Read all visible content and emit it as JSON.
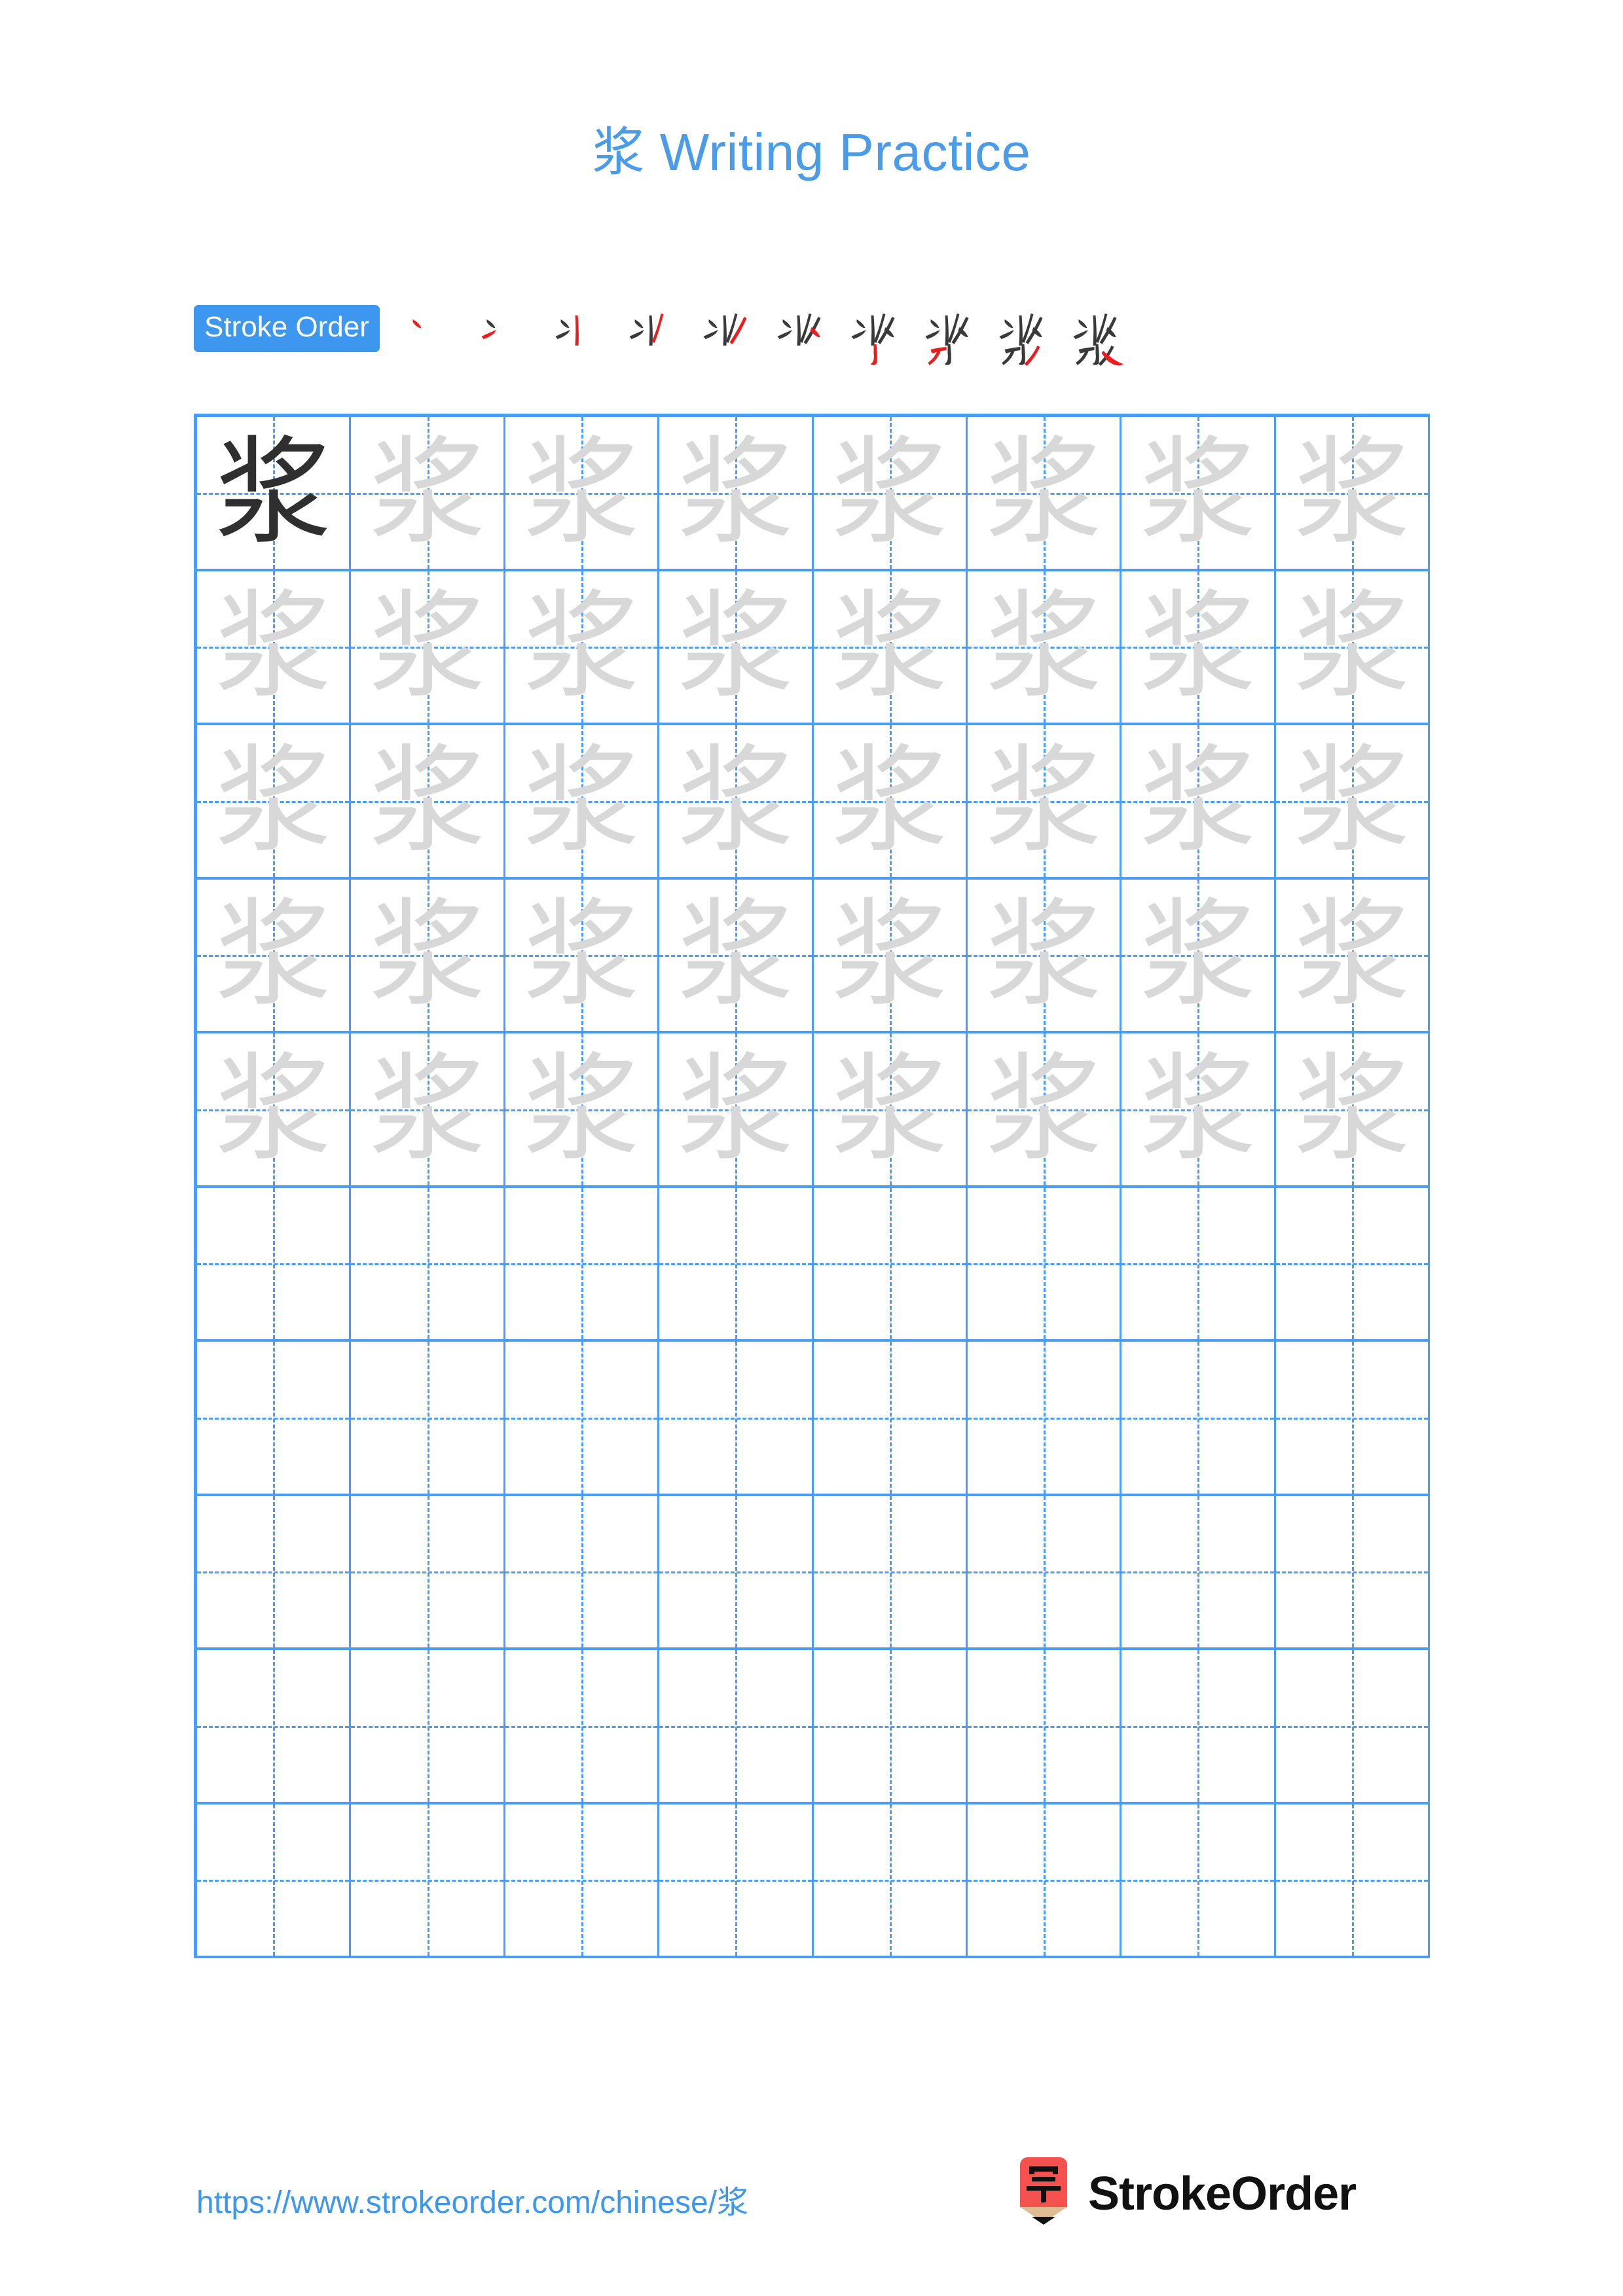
{
  "character": "浆",
  "title": {
    "han": "浆",
    "text": " Writing Practice",
    "full": "浆 Writing Practice",
    "color": "#4a9ce8"
  },
  "stroke_order": {
    "label": "Stroke Order",
    "badge_bg": "#3d97ef",
    "badge_text_color": "#ffffff",
    "stroke_count": 10,
    "new_stroke_color": "#ee1c1c",
    "prev_stroke_color": "#3a3a3a",
    "steps": [
      {
        "index": 1,
        "name": "stroke-1-dian"
      },
      {
        "index": 2,
        "name": "stroke-2-dian"
      },
      {
        "index": 3,
        "name": "stroke-3-shu"
      },
      {
        "index": 4,
        "name": "stroke-4-pie"
      },
      {
        "index": 5,
        "name": "stroke-5-pie"
      },
      {
        "index": 6,
        "name": "stroke-6-dian"
      },
      {
        "index": 7,
        "name": "stroke-7-shu-gou"
      },
      {
        "index": 8,
        "name": "stroke-8-heng-pie"
      },
      {
        "index": 9,
        "name": "stroke-9-pie"
      },
      {
        "index": 10,
        "name": "stroke-10-na"
      }
    ]
  },
  "grid": {
    "columns": 8,
    "rows": 10,
    "line_color": "#4a9df5",
    "dark_char_color": "#2f2f2f",
    "trace_char_color": "#d8d8d8",
    "rows_data": [
      {
        "row": 1,
        "cells": [
          "浆",
          "浆",
          "浆",
          "浆",
          "浆",
          "浆",
          "浆",
          "浆"
        ],
        "first_dark": true
      },
      {
        "row": 2,
        "cells": [
          "浆",
          "浆",
          "浆",
          "浆",
          "浆",
          "浆",
          "浆",
          "浆"
        ],
        "first_dark": false
      },
      {
        "row": 3,
        "cells": [
          "浆",
          "浆",
          "浆",
          "浆",
          "浆",
          "浆",
          "浆",
          "浆"
        ],
        "first_dark": false
      },
      {
        "row": 4,
        "cells": [
          "浆",
          "浆",
          "浆",
          "浆",
          "浆",
          "浆",
          "浆",
          "浆"
        ],
        "first_dark": false
      },
      {
        "row": 5,
        "cells": [
          "浆",
          "浆",
          "浆",
          "浆",
          "浆",
          "浆",
          "浆",
          "浆"
        ],
        "first_dark": false
      },
      {
        "row": 6,
        "cells": [
          "",
          "",
          "",
          "",
          "",
          "",
          "",
          ""
        ],
        "first_dark": false
      },
      {
        "row": 7,
        "cells": [
          "",
          "",
          "",
          "",
          "",
          "",
          "",
          ""
        ],
        "first_dark": false
      },
      {
        "row": 8,
        "cells": [
          "",
          "",
          "",
          "",
          "",
          "",
          "",
          ""
        ],
        "first_dark": false
      },
      {
        "row": 9,
        "cells": [
          "",
          "",
          "",
          "",
          "",
          "",
          "",
          ""
        ],
        "first_dark": false
      },
      {
        "row": 10,
        "cells": [
          "",
          "",
          "",
          "",
          "",
          "",
          "",
          ""
        ],
        "first_dark": false
      }
    ]
  },
  "footer": {
    "url": "https://www.strokeorder.com/chinese/浆",
    "url_color": "#3d97ef",
    "brand_name": "StrokeOrder",
    "logo": {
      "name": "strokeorder-pencil-logo",
      "glyph": "字",
      "body_color": "#f4514f",
      "wood_color": "#e0bc94",
      "tip_color": "#111111"
    }
  }
}
